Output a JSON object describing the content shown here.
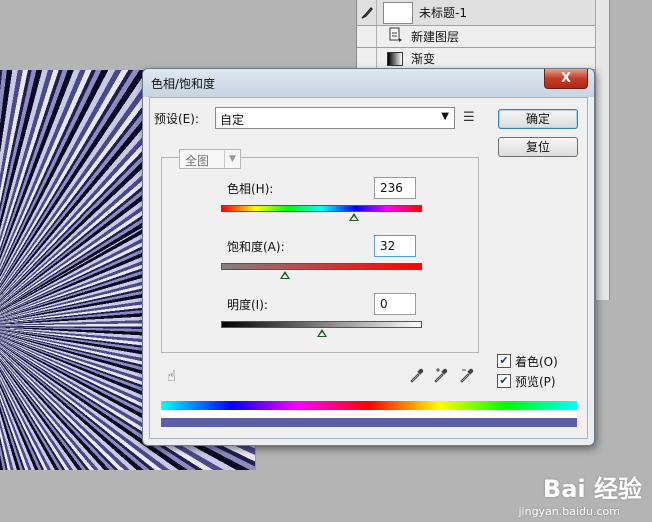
{
  "layers": [
    {
      "label": "未标题-1",
      "icon": "brush-icon"
    },
    {
      "label": "新建图层",
      "icon": "new-layer-icon"
    },
    {
      "label": "渐变",
      "icon": "gradient-icon"
    }
  ],
  "dialog": {
    "title": "色相/饱和度",
    "close_label": "X",
    "preset_label": "预设(E):",
    "preset_value": "自定",
    "ok_label": "确定",
    "reset_label": "复位",
    "channel_value": "全图",
    "hue_label": "色相(H):",
    "hue_value": "236",
    "saturation_label": "饱和度(A):",
    "saturation_value": "32",
    "lightness_label": "明度(I):",
    "lightness_value": "0",
    "colorize_label": "着色(O)",
    "colorize_checked": true,
    "preview_label": "预览(P)",
    "preview_checked": true,
    "check_mark": "✔",
    "hue_slider_fraction": 0.66,
    "saturation_slider_fraction": 0.32,
    "lightness_slider_fraction": 0.5,
    "tint_color": "#5c5ea6"
  },
  "watermark": {
    "brand": "Bai 经验",
    "url": "jingyan.baidu.com"
  }
}
